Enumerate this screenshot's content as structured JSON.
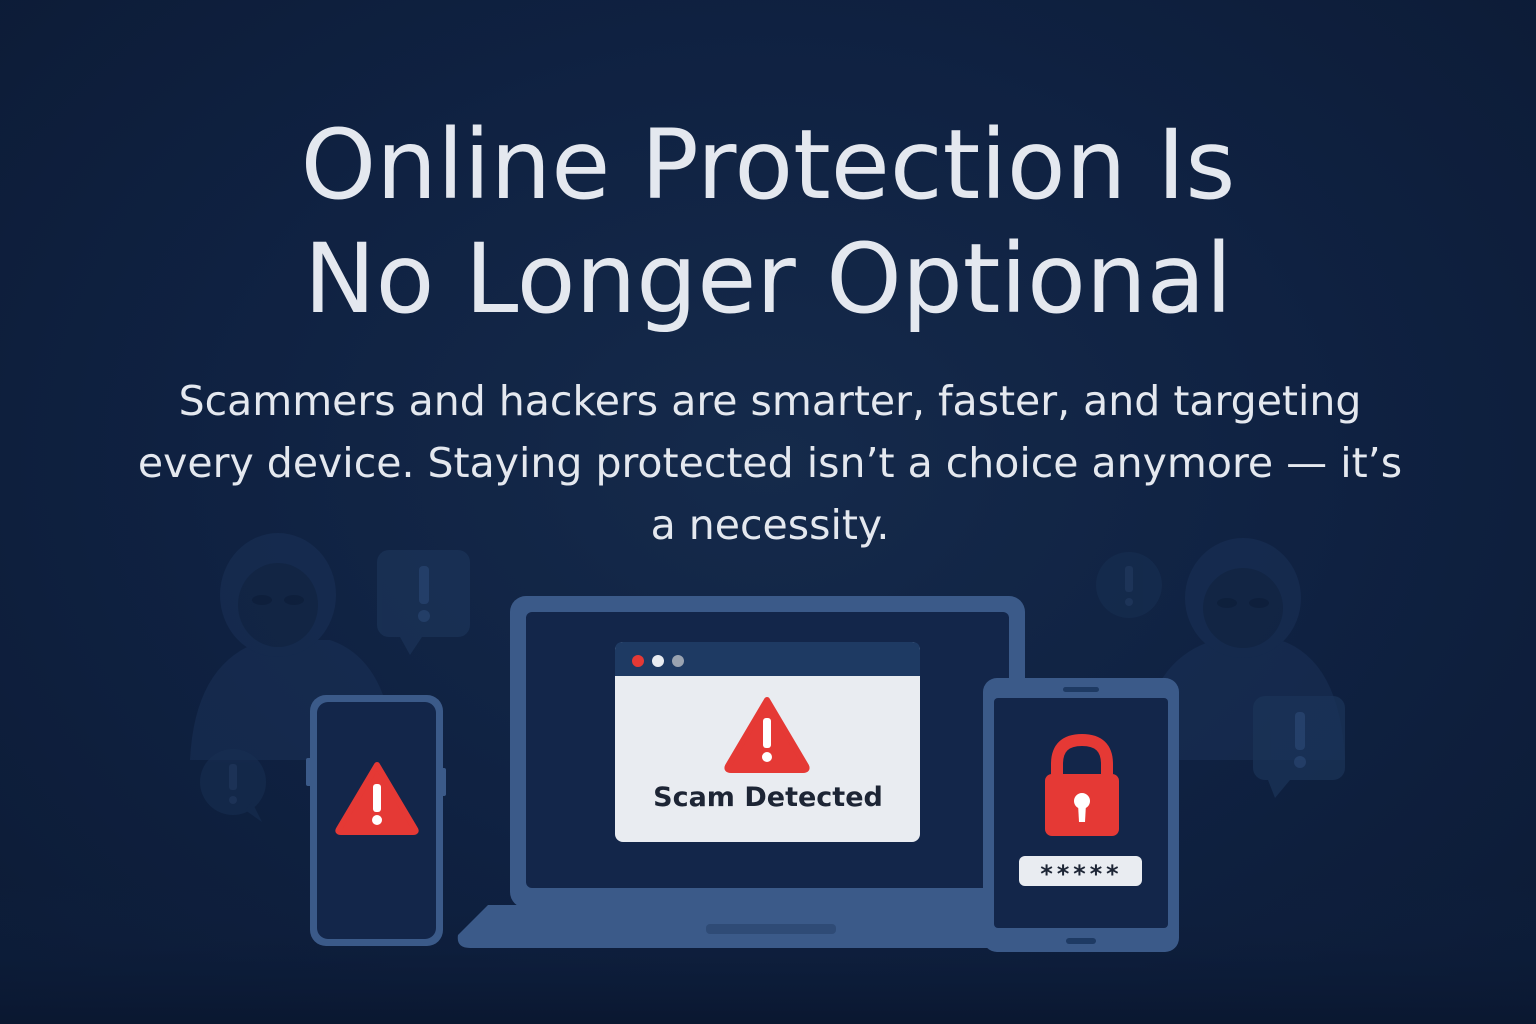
{
  "headline": {
    "line1": "Online Protection Is",
    "line2": "No Longer Optional"
  },
  "subtitle": "Scammers and hackers are smarter, faster, and targeting every device. Staying protected isn’t a choice anymore — it’s a necessity.",
  "laptop_popup": {
    "label": "Scam Detected",
    "window_dots": [
      "#e53935",
      "#e9ecf1",
      "#9aa3b1"
    ]
  },
  "tablet": {
    "password_mask": "*****"
  },
  "icons": {
    "phone": "warning-triangle-icon",
    "popup": "warning-triangle-icon",
    "tablet": "padlock-icon",
    "background": [
      "hooded-hacker-icon",
      "alert-speech-bubble-icon"
    ]
  },
  "colors": {
    "background": "#0f2141",
    "device_frame": "#3b5a89",
    "device_screen": "#13264a",
    "alert_red": "#e53935",
    "text_light": "#e4e8ef",
    "popup_body": "#e9ecf1"
  }
}
